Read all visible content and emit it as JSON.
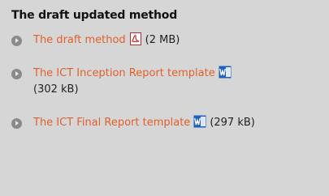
{
  "section": {
    "title": "The draft updated method",
    "items": [
      {
        "link": "The draft method",
        "icon": "pdf-icon",
        "size": "(2 MB)"
      },
      {
        "link": "The ICT Inception Report template",
        "icon": "word-doc-icon",
        "size": "(302 kB)"
      },
      {
        "link": "The ICT Final Report template",
        "icon": "word-doc-icon",
        "size": "(297 kB)"
      }
    ]
  },
  "colors": {
    "background": "#d6d6d6",
    "link": "#e2602a",
    "bullet": "#8a8a8a"
  }
}
